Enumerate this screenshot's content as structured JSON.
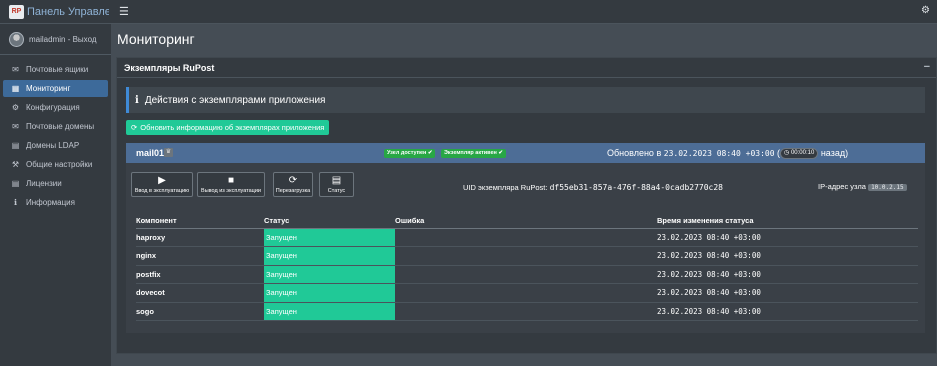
{
  "brand": {
    "logo": "RP",
    "title": "Панель Управления"
  },
  "topbar": {
    "menu_icon": "hamburger-icon",
    "settings_icon": "gear-icon"
  },
  "user": {
    "name": "mailadmin",
    "separator": " - ",
    "logout": "Выход"
  },
  "sidebar": {
    "items": [
      {
        "label": "Почтовые ящики",
        "icon": "envelope-icon",
        "glyph": "✉",
        "active": false
      },
      {
        "label": "Мониторинг",
        "icon": "grid-icon",
        "glyph": "▦",
        "active": true
      },
      {
        "label": "Конфигурация",
        "icon": "cog-icon",
        "glyph": "⚙",
        "active": false
      },
      {
        "label": "Почтовые домены",
        "icon": "envelope-open-icon",
        "glyph": "✉",
        "active": false
      },
      {
        "label": "Домены LDAP",
        "icon": "address-book-icon",
        "glyph": "▤",
        "active": false
      },
      {
        "label": "Общие настройки",
        "icon": "wrench-icon",
        "glyph": "⚒",
        "active": false
      },
      {
        "label": "Лицензии",
        "icon": "license-icon",
        "glyph": "▤",
        "active": false
      },
      {
        "label": "Информация",
        "icon": "info-icon",
        "glyph": "ℹ",
        "active": false
      }
    ]
  },
  "page": {
    "title": "Мониторинг"
  },
  "card": {
    "title": "Экземпляры RuPost",
    "collapse": "−",
    "callout": "Действия с экземплярами приложения",
    "refresh": "Обновить информацию об экземплярах приложения"
  },
  "instance": {
    "name": "mail01",
    "badge_available": "Узел доступен",
    "badge_active": "Экземпляр активен",
    "updated_prefix": "Обновлено в",
    "updated_at": "23.02.2023 08:40 +03:00",
    "timer": "00:00:10",
    "updated_suffix": "назад)",
    "buttons": {
      "start": "Ввод в эксплуатацию",
      "stop": "Вывод из эксплуатации",
      "restart": "Перезагрузка",
      "status": "Статус"
    },
    "uid_label": "UID экземпляра RuPost:",
    "uid": "df55eb31-857a-476f-88a4-0cadb2770c28",
    "ip_label": "IP-адрес узла",
    "ip": "10.0.2.15"
  },
  "table": {
    "headers": [
      "Компонент",
      "Статус",
      "Ошибка",
      "Время изменения статуса"
    ],
    "rows": [
      {
        "component": "haproxy",
        "status": "Запущен",
        "error": "",
        "time": "23.02.2023 08:40 +03:00"
      },
      {
        "component": "nginx",
        "status": "Запущен",
        "error": "",
        "time": "23.02.2023 08:40 +03:00"
      },
      {
        "component": "postfix",
        "status": "Запущен",
        "error": "",
        "time": "23.02.2023 08:40 +03:00"
      },
      {
        "component": "dovecot",
        "status": "Запущен",
        "error": "",
        "time": "23.02.2023 08:40 +03:00"
      },
      {
        "component": "sogo",
        "status": "Запущен",
        "error": "",
        "time": "23.02.2023 08:40 +03:00"
      }
    ]
  },
  "colors": {
    "accent": "#3d6a9a",
    "success": "#20c997",
    "badge": "#28a745",
    "instance_header": "#4d6d96"
  }
}
